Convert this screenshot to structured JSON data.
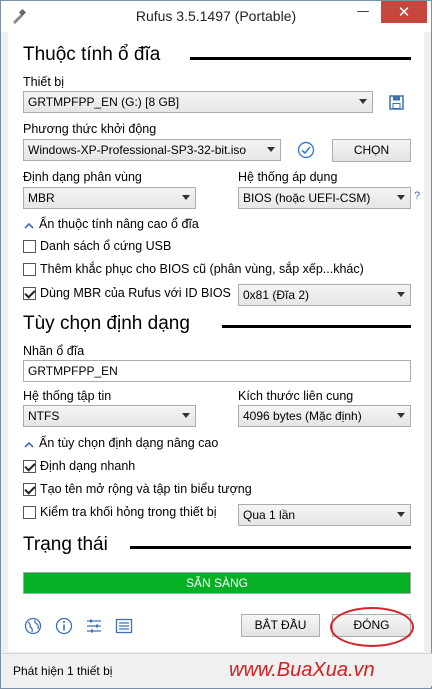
{
  "window": {
    "title": "Rufus 3.5.1497 (Portable)"
  },
  "drive_properties": {
    "heading": "Thuộc tính ổ đĩa",
    "device_label": "Thiết bị",
    "device_value": "GRTMPFPP_EN (G:) [8 GB]",
    "boot_label": "Phương thức khởi động",
    "boot_value": "Windows-XP-Professional-SP3-32-bit.iso",
    "select_button": "CHỌN",
    "partition_label": "Định dạng phân vùng",
    "partition_value": "MBR",
    "target_label": "Hệ thống áp dụng",
    "target_value": "BIOS (hoặc UEFI-CSM)",
    "help_mark": "?",
    "advanced_toggle": "Ẩn thuộc tính nâng cao ổ đĩa",
    "usb_list": {
      "label": "Danh sách ổ cứng USB",
      "checked": false
    },
    "bios_fix": {
      "label": "Thêm khắc phục cho BIOS cũ (phân vùng, sắp xếp...khác)",
      "checked": false
    },
    "rufus_mbr": {
      "label": "Dùng MBR của Rufus với ID BIOS",
      "checked": true
    },
    "bios_id_value": "0x81 (Đĩa 2)"
  },
  "format_options": {
    "heading": "Tùy chọn định dạng",
    "volume_label": "Nhãn ổ đĩa",
    "volume_value": "GRTMPFPP_EN",
    "fs_label": "Hệ thống tập tin",
    "fs_value": "NTFS",
    "cluster_label": "Kích thước liên cung",
    "cluster_value": "4096 bytes (Mặc định)",
    "advanced_toggle": "Ẩn tùy chọn định dạng nâng cao",
    "quick_format": {
      "label": "Định dạng nhanh",
      "checked": true
    },
    "extended_label": {
      "label": "Tạo tên mở rộng và tập tin biểu tượng",
      "checked": true
    },
    "bad_blocks": {
      "label": "Kiểm tra khối hỏng trong thiết bị",
      "checked": false
    },
    "passes_value": "Qua 1 lần"
  },
  "status": {
    "heading": "Trạng thái",
    "progress_text": "SẴN SÀNG",
    "progress_fraction": 1.0,
    "progress_color": "#06b025"
  },
  "bottom_bar": {
    "icons": [
      "globe-icon",
      "info-icon",
      "settings-icon",
      "log-icon"
    ],
    "start_button": "BẮT ĐẦU",
    "close_button": "ĐÓNG"
  },
  "statusbar": {
    "text": "Phát hiện 1 thiết bị"
  },
  "watermark": {
    "text": "www.BuaXua.vn"
  }
}
